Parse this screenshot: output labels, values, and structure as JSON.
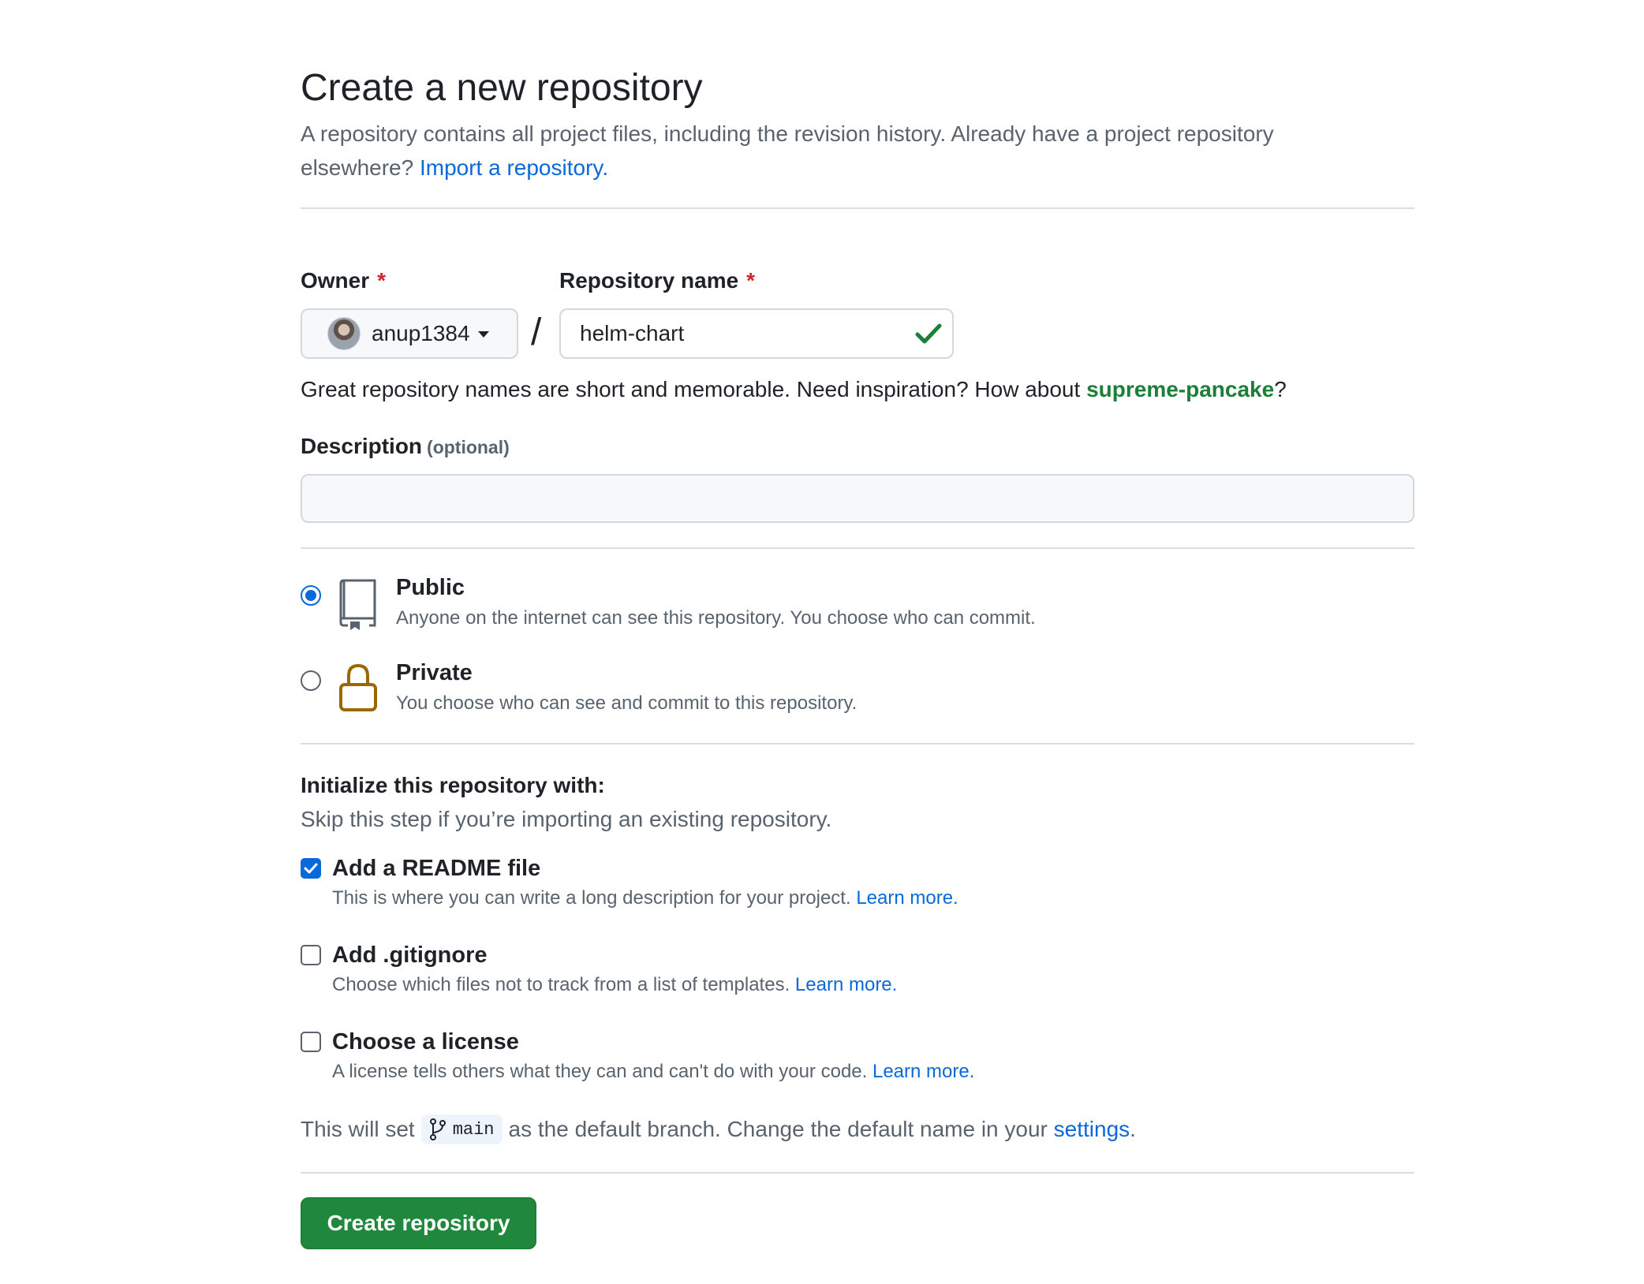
{
  "header": {
    "title": "Create a new repository",
    "subtitle": "A repository contains all project files, including the revision history. Already have a project repository elsewhere?",
    "import_link": "Import a repository."
  },
  "owner": {
    "label": "Owner",
    "required_mark": "*",
    "value": "anup1384"
  },
  "repository": {
    "label": "Repository name",
    "required_mark": "*",
    "value": "helm-chart",
    "valid": true
  },
  "name_hint": {
    "text": "Great repository names are short and memorable. Need inspiration? How about",
    "suggestion": "supreme-pancake",
    "suffix": "?"
  },
  "description": {
    "label": "Description",
    "optional": "(optional)",
    "value": ""
  },
  "visibility": {
    "selected": "public",
    "public": {
      "title": "Public",
      "desc": "Anyone on the internet can see this repository. You choose who can commit."
    },
    "private": {
      "title": "Private",
      "desc": "You choose who can see and commit to this repository."
    }
  },
  "initialize": {
    "title": "Initialize this repository with:",
    "subtitle": "Skip this step if you’re importing an existing repository.",
    "readme": {
      "title": "Add a README file",
      "desc": "This is where you can write a long description for your project.",
      "link": "Learn more.",
      "checked": true
    },
    "gitignore": {
      "title": "Add .gitignore",
      "desc": "Choose which files not to track from a list of templates.",
      "link": "Learn more.",
      "checked": false
    },
    "license": {
      "title": "Choose a license",
      "desc": "A license tells others what they can and can't do with your code.",
      "link": "Learn more.",
      "checked": false
    }
  },
  "branch": {
    "prefix": "This will set",
    "name": "main",
    "middle": "as the default branch. Change the default name in your",
    "link": "settings",
    "suffix": "."
  },
  "actions": {
    "create_label": "Create repository"
  },
  "colors": {
    "accent": "#0969da",
    "primary_button": "#1f883d",
    "success": "#1a7f37",
    "required": "#d1242f",
    "lock_icon": "#9a6700"
  }
}
